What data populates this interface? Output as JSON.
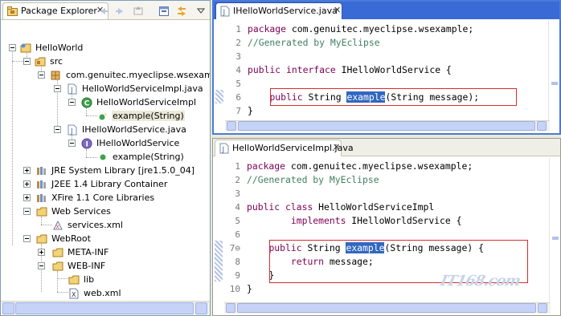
{
  "package_explorer": {
    "tab_label": "Package Explorer",
    "close_glyph": "✕",
    "tree": [
      {
        "label": "HelloWorld",
        "icon": "project-icon"
      },
      {
        "label": "src",
        "icon": "source-folder-icon"
      },
      {
        "label": "com.genuitec.myeclipse.wsexample",
        "icon": "package-icon"
      },
      {
        "label": "HelloWorldServiceImpl.java",
        "icon": "java-file-icon"
      },
      {
        "label": "HelloWorldServiceImpl",
        "icon": "class-icon"
      },
      {
        "label": "example(String)",
        "icon": "method-icon"
      },
      {
        "label": "IHelloWorldService.java",
        "icon": "java-file-icon"
      },
      {
        "label": "IHelloWorldService",
        "icon": "interface-icon"
      },
      {
        "label": "example(String)",
        "icon": "method-icon"
      },
      {
        "label": "JRE System Library [jre1.5.0_04]",
        "icon": "library-icon"
      },
      {
        "label": "J2EE 1.4 Library Container",
        "icon": "library-icon"
      },
      {
        "label": "XFire 1.1 Core Libraries",
        "icon": "library-icon"
      },
      {
        "label": "Web Services",
        "icon": "folder-icon"
      },
      {
        "label": "services.xml",
        "icon": "xml-file-icon"
      },
      {
        "label": "WebRoot",
        "icon": "folder-icon"
      },
      {
        "label": "META-INF",
        "icon": "folder-icon"
      },
      {
        "label": "WEB-INF",
        "icon": "folder-icon"
      },
      {
        "label": "lib",
        "icon": "folder-icon"
      },
      {
        "label": "web.xml",
        "icon": "xml-file-icon"
      }
    ]
  },
  "editor1": {
    "tab_label": "IHelloWorldService.java",
    "close_glyph": "✕",
    "lines": [
      {
        "num": "1",
        "segments": [
          {
            "t": "package",
            "c": "kw"
          },
          {
            "t": " com.genuitec.myeclipse.wsexample;",
            "c": "ty"
          }
        ]
      },
      {
        "num": "2",
        "segments": [
          {
            "t": "//Generated by MyEclipse",
            "c": "cm"
          }
        ]
      },
      {
        "num": "3",
        "segments": []
      },
      {
        "num": "4",
        "segments": [
          {
            "t": "public",
            "c": "kw"
          },
          {
            "t": " ",
            "c": "ty"
          },
          {
            "t": "interface",
            "c": "kw"
          },
          {
            "t": " IHelloWorldService {",
            "c": "ty"
          }
        ]
      },
      {
        "num": "5",
        "segments": []
      },
      {
        "num": "6",
        "segments": [
          {
            "t": "    ",
            "c": "ty"
          },
          {
            "t": "public",
            "c": "kw"
          },
          {
            "t": " String ",
            "c": "ty"
          },
          {
            "t": "example",
            "c": "hl"
          },
          {
            "t": "(String message);",
            "c": "ty"
          }
        ]
      },
      {
        "num": "7",
        "segments": [
          {
            "t": "}",
            "c": "ty"
          }
        ]
      }
    ]
  },
  "editor2": {
    "tab_label": "HelloWorldServiceImpl.java",
    "close_glyph": "✕",
    "lines": [
      {
        "num": "1",
        "segments": [
          {
            "t": "package",
            "c": "kw"
          },
          {
            "t": " com.genuitec.myeclipse.wsexample;",
            "c": "ty"
          }
        ]
      },
      {
        "num": "2",
        "segments": [
          {
            "t": "//Generated by MyEclipse",
            "c": "cm"
          }
        ]
      },
      {
        "num": "3",
        "segments": []
      },
      {
        "num": "4",
        "segments": [
          {
            "t": "public",
            "c": "kw"
          },
          {
            "t": " ",
            "c": "ty"
          },
          {
            "t": "class",
            "c": "kw"
          },
          {
            "t": " HelloWorldServiceImpl",
            "c": "ty"
          }
        ]
      },
      {
        "num": "5",
        "segments": [
          {
            "t": "        ",
            "c": "ty"
          },
          {
            "t": "implements",
            "c": "kw"
          },
          {
            "t": " IHelloWorldService {",
            "c": "ty"
          }
        ]
      },
      {
        "num": "6",
        "segments": []
      },
      {
        "num": "7⊖",
        "segments": [
          {
            "t": "    ",
            "c": "ty"
          },
          {
            "t": "public",
            "c": "kw"
          },
          {
            "t": " String ",
            "c": "ty"
          },
          {
            "t": "example",
            "c": "hl"
          },
          {
            "t": "(String message) {",
            "c": "ty"
          }
        ]
      },
      {
        "num": "8",
        "segments": [
          {
            "t": "        ",
            "c": "ty"
          },
          {
            "t": "return",
            "c": "kw"
          },
          {
            "t": " message;",
            "c": "ty"
          }
        ]
      },
      {
        "num": "9",
        "segments": [
          {
            "t": "    }",
            "c": "ty"
          }
        ]
      },
      {
        "num": "10",
        "segments": [
          {
            "t": "}",
            "c": "ty"
          }
        ]
      }
    ]
  },
  "watermark": "IT168.com",
  "colors": {
    "keyword": "#7f0055",
    "comment": "#3f7f5f",
    "highlight": "#3167c1",
    "redbox": "#d62d2d",
    "active_tab_bar": "#3a6ad6"
  }
}
